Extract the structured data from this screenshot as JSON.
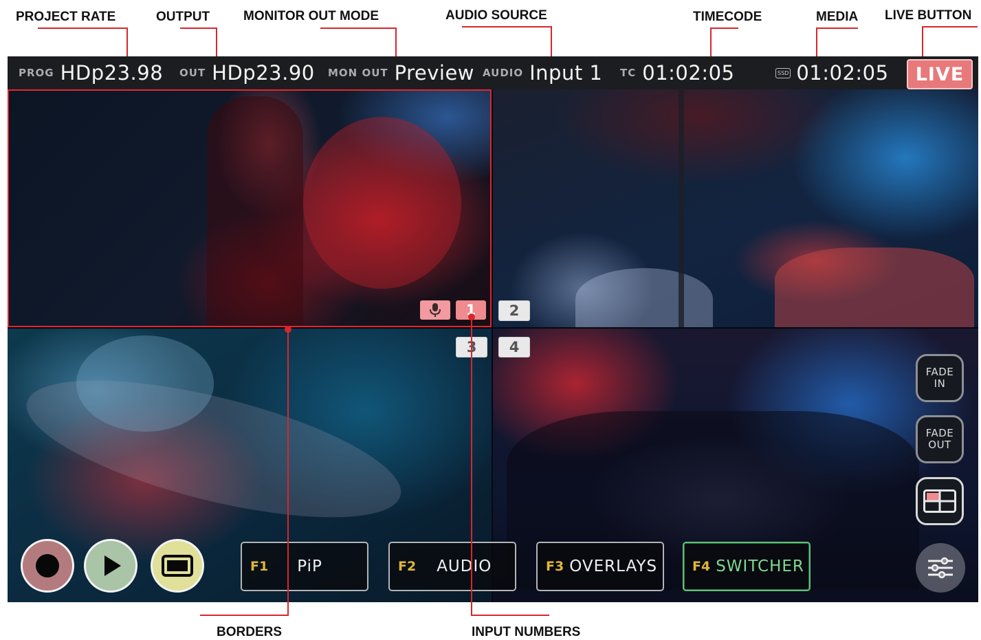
{
  "callouts": {
    "project_rate": "PROJECT RATE",
    "output": "OUTPUT",
    "monitor_out_mode": "MONITOR OUT MODE",
    "audio_source": "AUDIO SOURCE",
    "timecode": "TIMECODE",
    "media": "MEDIA",
    "live_button": "LIVE BUTTON",
    "borders": "BORDERS",
    "input_numbers": "INPUT NUMBERS"
  },
  "status_bar": {
    "prog_label": "PROG",
    "prog_value": "HDp23.98",
    "out_label": "OUT",
    "out_value": "HDp23.90",
    "mon_out_label": "MON OUT",
    "mon_out_value": "Preview",
    "audio_label": "AUDIO",
    "audio_value": "Input 1",
    "tc_label": "TC",
    "tc_value": "01:02:05",
    "media_icon_label": "SSD",
    "media_value": "01:02:05",
    "live_label": "LIVE"
  },
  "inputs": {
    "one": "1",
    "two": "2",
    "three": "3",
    "four": "4",
    "live_input": "1",
    "audio_input": "1"
  },
  "side_buttons": {
    "fade_in_line1": "FADE",
    "fade_in_line2": "IN",
    "fade_out_line1": "FADE",
    "fade_out_line2": "OUT"
  },
  "function_keys": [
    {
      "id": "F1",
      "label": "PiP"
    },
    {
      "id": "F2",
      "label": "AUDIO"
    },
    {
      "id": "F3",
      "label": "OVERLAYS"
    },
    {
      "id": "F4",
      "label": "SWITCHER"
    }
  ],
  "icons": {
    "record": "record-icon",
    "play": "play-icon",
    "display": "display-icon",
    "microphone": "microphone-icon",
    "layout": "quad-layout-icon",
    "settings": "sliders-icon",
    "media": "ssd-icon"
  },
  "colors": {
    "accent_red": "#e5262f",
    "live_bg": "#e8797b",
    "fkey_id": "#e0b63a",
    "switcher_active": "#5fbf7a",
    "record_fill": "#b47b7e",
    "play_fill": "#a9c4a6",
    "display_fill": "#e0e09a"
  }
}
